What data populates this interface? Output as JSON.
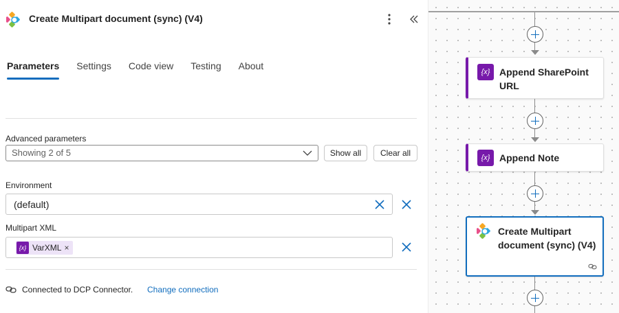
{
  "panel": {
    "title": "Create Multipart document (sync) (V4)",
    "tabs": [
      "Parameters",
      "Settings",
      "Code view",
      "Testing",
      "About"
    ],
    "active_tab": "Parameters",
    "advanced": {
      "label": "Advanced parameters",
      "value": "Showing 2 of 5",
      "show_all": "Show all",
      "clear_all": "Clear all"
    },
    "environment": {
      "label": "Environment",
      "value": "(default)"
    },
    "multipart_xml": {
      "label": "Multipart XML",
      "token_icon": "{x}",
      "token_label": "VarXML",
      "token_remove": "×"
    },
    "connection": {
      "text": "Connected to DCP Connector.",
      "change_link": "Change connection"
    }
  },
  "canvas": {
    "cards": [
      {
        "title_line1": "Append SharePoint",
        "title_line2": "URL",
        "icon": "{x}",
        "kind": "variable"
      },
      {
        "title_line1": "Append Note",
        "icon": "{x}",
        "kind": "variable"
      },
      {
        "title_line1": "Create Multipart",
        "title_line2": "document (sync) (V4)",
        "kind": "connector",
        "selected": true
      }
    ]
  },
  "colors": {
    "accent": "#0f6cbd",
    "variable_purple": "#7719aa",
    "token_bg": "#ede3f7"
  },
  "icons": [
    "app-logo-icon",
    "more-vertical-icon",
    "collapse-chevrons-icon",
    "chevron-down-icon",
    "close-icon",
    "link-icon",
    "plus-icon",
    "variable-icon"
  ]
}
